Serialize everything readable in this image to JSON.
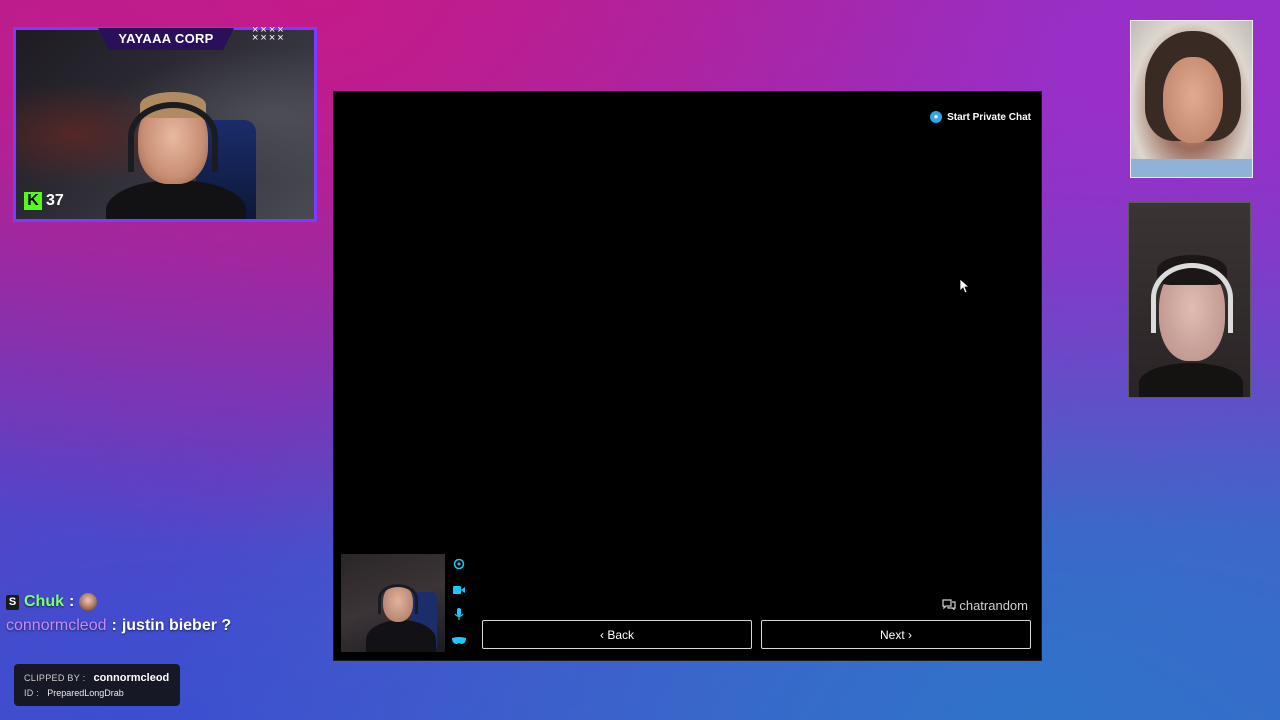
{
  "overlay": {
    "cam_title": "YAYAAA CORP",
    "cam_deco": "××××\n××××",
    "kick_icon": "K",
    "viewer_count": "37",
    "brand_color": "#53fc18",
    "frame_color": "#7b3cff"
  },
  "app": {
    "private_chat_label": "Start Private Chat",
    "back_label": "‹ Back",
    "next_label": "Next ›",
    "brand": "chatrandom",
    "brand_icon": "chat-bubble-icon",
    "controls": [
      {
        "name": "camera-switch-icon",
        "glyph": "⟳"
      },
      {
        "name": "video-camera-icon",
        "glyph": "■"
      },
      {
        "name": "microphone-icon",
        "glyph": "♩"
      },
      {
        "name": "mask-icon",
        "glyph": "◠"
      }
    ],
    "accent_color": "#1ec8ff"
  },
  "stream_chat": {
    "messages": [
      {
        "user": "Chuk",
        "separator": " :",
        "text": "",
        "user_color": "#7dff72",
        "has_emote": true
      },
      {
        "user": "connormcleod",
        "separator": " :",
        "text": " justin bieber ?",
        "user_color": "#c58cff",
        "has_emote": false
      }
    ],
    "clip": {
      "clipped_by_label": "CLIPPED BY :",
      "clipped_by_value": "connormcleod",
      "id_label": "ID :",
      "id_value": "PreparedLongDrab"
    }
  }
}
